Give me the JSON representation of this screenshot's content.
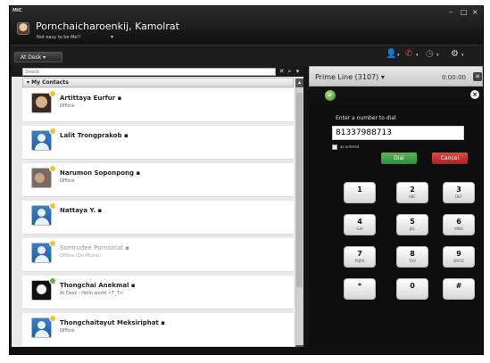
{
  "app": {
    "logo": "MIC"
  },
  "window_controls": {
    "minimize": "–",
    "maximize": "□",
    "close": "×"
  },
  "user": {
    "name": "Pornchaicharoenkij, Kamolrat",
    "status": "Not easy to be Me!!",
    "status_caret": "▾"
  },
  "toolbar": {
    "status_button": "At Desk ▾",
    "icons": [
      "contacts-icon",
      "phone-icon",
      "clock-icon",
      "gear-icon"
    ]
  },
  "search": {
    "placeholder": "Search"
  },
  "contacts": {
    "group_label": "▾ My Contacts",
    "items": [
      {
        "name": "Artittaya Eurfur ▪",
        "sub": "Offline",
        "presence": "yellow",
        "pic": "photo1"
      },
      {
        "name": "Lalit Trongprakob ▪",
        "sub": "",
        "presence": "yellow",
        "pic": "generic"
      },
      {
        "name": "Narumon Soponpong ▪",
        "sub": "Offline",
        "presence": "yellow",
        "pic": "photo2"
      },
      {
        "name": "Nattaya Y. ▪",
        "sub": "",
        "presence": "yellow",
        "pic": "generic"
      },
      {
        "name": "Somrudee Pornsiriat ▪",
        "sub": "Offline (On Phone)",
        "presence": "yellow",
        "pic": "generic"
      },
      {
        "name": "Thongchai Anekmal ▪",
        "sub": "At Desk - Hello world <T_T>",
        "presence": "green",
        "pic": "photo3"
      },
      {
        "name": "Thongchaitayut Meksiriphat ▪",
        "sub": "Offline",
        "presence": "yellow",
        "pic": "generic"
      }
    ]
  },
  "line": {
    "title": "Prime Line (3107) ▾",
    "timer": "0:00:00",
    "prompt": "Enter a number to dial",
    "number": "81337988713",
    "as_entered_label": "as entered",
    "dial_label": "Dial",
    "cancel_label": "Cancel"
  },
  "keypad": [
    {
      "d": "1",
      "l": ""
    },
    {
      "d": "2",
      "l": "ABC"
    },
    {
      "d": "3",
      "l": "DEF"
    },
    {
      "d": "4",
      "l": "GHI"
    },
    {
      "d": "5",
      "l": "JKL"
    },
    {
      "d": "6",
      "l": "MNO"
    },
    {
      "d": "7",
      "l": "PQRS"
    },
    {
      "d": "8",
      "l": "TUV"
    },
    {
      "d": "9",
      "l": "WXYZ"
    },
    {
      "d": "*",
      "l": ""
    },
    {
      "d": "0",
      "l": ""
    },
    {
      "d": "#",
      "l": ""
    }
  ]
}
